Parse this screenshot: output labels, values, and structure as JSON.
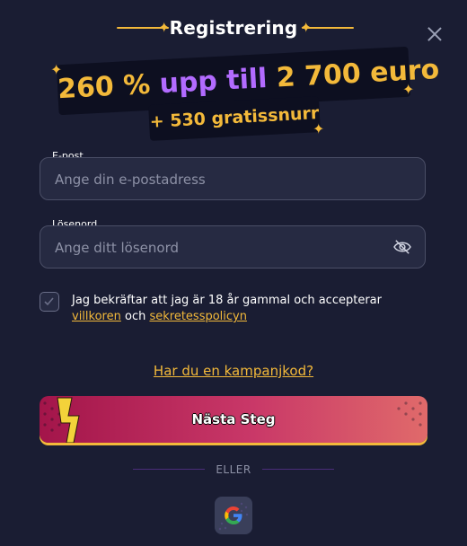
{
  "header": {
    "title": "Registrering",
    "close_icon": "close-icon"
  },
  "promo": {
    "line1_part1": "260 %",
    "line1_part2": "upp till",
    "line1_part3": "2 700 euro",
    "line2": "+ 530 gratissnurr"
  },
  "form": {
    "email": {
      "label": "E-post",
      "placeholder": "Ange din e-postadress",
      "value": ""
    },
    "password": {
      "label": "Lösenord",
      "placeholder": "Ange ditt lösenord",
      "value": "",
      "toggle_icon": "eye-slash-icon"
    },
    "consent": {
      "text_before": "Jag bekräftar att jag är 18 år gammal och accepterar",
      "terms_link": "villkoren",
      "text_mid": "och",
      "privacy_link": "sekretesspolicyn",
      "checked": false
    },
    "promo_code_link": "Har du en kampanjkod?",
    "next_button": "Nästa Steg"
  },
  "divider": {
    "label": "ELLER"
  },
  "social": {
    "google_icon": "google-icon"
  },
  "colors": {
    "background": "#1a1d33",
    "accent_yellow": "#f3b93a",
    "accent_purple": "#b26bff",
    "button_start": "#a3154a",
    "button_end": "#e06a6a"
  }
}
